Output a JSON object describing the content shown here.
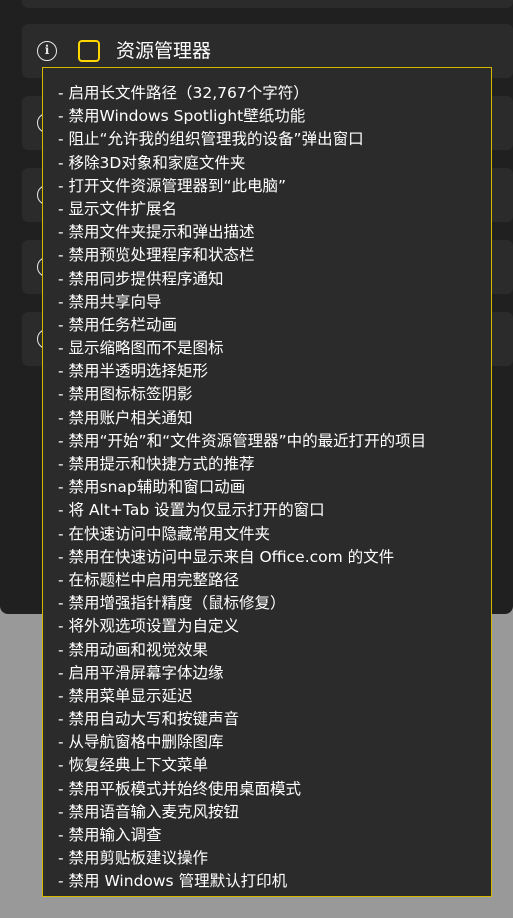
{
  "colors": {
    "background": "#999999",
    "panel": "#202020",
    "card": "#2b2b2b",
    "accent": "#ffd600",
    "text": "#ffffff"
  },
  "setting": {
    "icon": "info-icon",
    "title": "资源管理器",
    "checked": false
  },
  "tooltip": {
    "items": [
      "- 启用长文件路径（32,767个字符）",
      "- 禁用Windows Spotlight壁纸功能",
      "- 阻止“允许我的组织管理我的设备”弹出窗口",
      "- 移除3D对象和家庭文件夹",
      "- 打开文件资源管理器到“此电脑”",
      "- 显示文件扩展名",
      "- 禁用文件夹提示和弹出描述",
      "- 禁用预览处理程序和状态栏",
      "- 禁用同步提供程序通知",
      "- 禁用共享向导",
      "- 禁用任务栏动画",
      "- 显示缩略图而不是图标",
      "- 禁用半透明选择矩形",
      "- 禁用图标标签阴影",
      "- 禁用账户相关通知",
      "- 禁用“开始”和“文件资源管理器”中的最近打开的项目",
      "- 禁用提示和快捷方式的推荐",
      "- 禁用snap辅助和窗口动画",
      "- 将 Alt+Tab 设置为仅显示打开的窗口",
      "- 在快速访问中隐藏常用文件夹",
      "- 禁用在快速访问中显示来自 Office.com 的文件",
      "- 在标题栏中启用完整路径",
      "- 禁用增强指针精度（鼠标修复）",
      "- 将外观选项设置为自定义",
      "- 禁用动画和视觉效果",
      "- 启用平滑屏幕字体边缘",
      "- 禁用菜单显示延迟",
      "- 禁用自动大写和按键声音",
      "- 从导航窗格中删除图库",
      "- 恢复经典上下文菜单",
      "- 禁用平板模式并始终使用桌面模式",
      "- 禁用语音输入麦克风按钮",
      "- 禁用输入调查",
      "- 禁用剪贴板建议操作",
      "- 禁用 Windows 管理默认打印机"
    ]
  }
}
